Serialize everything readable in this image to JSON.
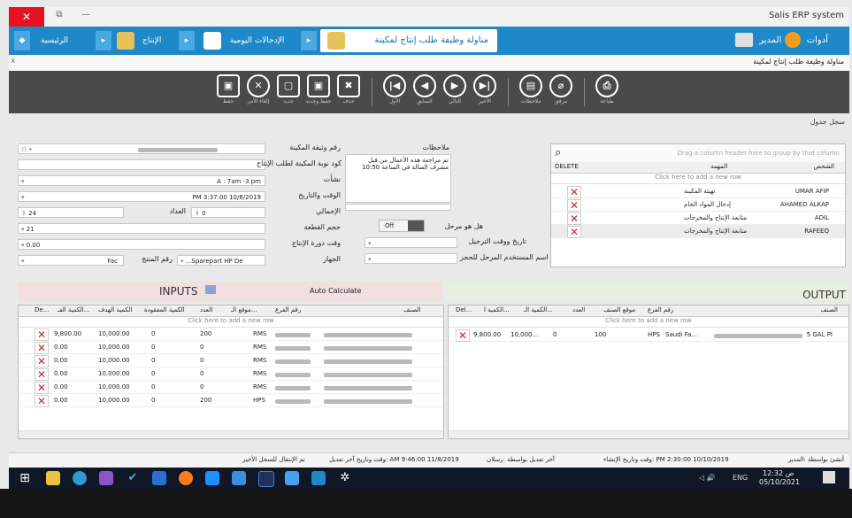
{
  "window": {
    "title": "Salis ERP system",
    "close_glyph": "✕",
    "restore_glyph": "⧉",
    "min_glyph": "—"
  },
  "nav": {
    "home": "الرئيسية",
    "production": "الإنتاج",
    "daily_entries": "الإدخالات اليومية",
    "active_tab": "مناولة وظيفة طلب إنتاج لمكينة",
    "tools": "أدوات",
    "user": "المدير"
  },
  "subbar": {
    "close_x": "x",
    "doc_tab": "مناولة وظيفة طلب إنتاج لمكينة"
  },
  "toolbar": {
    "save": "حفظ",
    "cancel": "إلغاء الأمر",
    "new": "جديد",
    "save_new": "حفظ وجديد",
    "delete": "حذف",
    "first": "الأول",
    "prev": "السابق",
    "next": "التالي",
    "last": "الأخير",
    "notes": "ملاحظات",
    "attach": "مرفق",
    "print": "طباعة"
  },
  "crumbs": {
    "left": "سجل  جدول"
  },
  "form": {
    "labels": {
      "machine_doc_no": "رقم وثيقة المكينة",
      "shift_code": "كود نوبة المكينة لطلب الإنتاج",
      "shift": "نشأت",
      "time_date": "الوقت والتاريخ",
      "total": "الإجمالي",
      "piece_size": "حجم القطعة",
      "cycle_time": "وقت دورة الإنتاج",
      "machine": "الجهاز",
      "counter": "العداد",
      "product_no": "رقم المنتج",
      "notes": "ملاحظات"
    },
    "values": {
      "shift_value": "A : 7am -3 pm",
      "datetime_value": "PM 3:37:00 10/8/2019",
      "total_value": "24",
      "piece_value": "21",
      "cycle_value": "0.00",
      "fac": "Fac",
      "sparepart": "...Sparepart HP De",
      "counter_value": "0",
      "notes_text": "تم مراجعة هذه الأعمال من قبل مشرف الصالة في الساعة 10:50",
      "toggle": "Off"
    },
    "qs": {
      "stage": "هل هو مرحل",
      "transfer_time": "تاريخ ووقت الترحيل",
      "transfer_user": "اسم المستخدم المرحل للحجز"
    }
  },
  "tasks_grid": {
    "hint": "Drag a column header here to group by that column",
    "headers": {
      "person": "الشخص",
      "task": "المهمة",
      "delete": "DELETE"
    },
    "add_row": "Click here to add a new row",
    "rows": [
      {
        "person": "UMAR AFIP",
        "task": "تهيئة المكينة"
      },
      {
        "person": "AHAMED ALKAP",
        "task": "إدخال المواد الخام"
      },
      {
        "person": "ADIL",
        "task": "متابعة الإنتاج والمخرجات"
      },
      {
        "person": "RAFEEQ",
        "task": "متابعة الإنتاج والمخرجات"
      }
    ]
  },
  "inputs": {
    "title": "INPUTS",
    "auto_calc": "Auto Calculate",
    "headers": {
      "item": "الصنف",
      "branch_no": "رقم الفرع",
      "location": "موقع الـ...",
      "count": "العدد",
      "qty_wasted": "الكمية المفقودة",
      "target_qty": "الكمية الهدف",
      "actual_qty": "الكمية الفـ...",
      "del": "De..."
    },
    "add_row": "Click here to add a new row",
    "rows": [
      {
        "loc": "RMS",
        "count": "200",
        "wasted": "0",
        "target": "10,000.00",
        "actual": "9,800.00"
      },
      {
        "loc": "RMS",
        "count": "0",
        "wasted": "0",
        "target": "10,000.00",
        "actual": "0.00"
      },
      {
        "loc": "RMS",
        "count": "0",
        "wasted": "0",
        "target": "10,000.00",
        "actual": "0.00"
      },
      {
        "loc": "RMS",
        "count": "0",
        "wasted": "0",
        "target": "10,000.00",
        "actual": "0.00"
      },
      {
        "loc": "RMS",
        "count": "0",
        "wasted": "0",
        "target": "10,000.00",
        "actual": "0.00"
      },
      {
        "loc": "HPS",
        "count": "200",
        "wasted": "0",
        "target": "10,000.00",
        "actual": "0.00"
      }
    ]
  },
  "output": {
    "title": "OUTPUT",
    "headers": {
      "item": "الصنف",
      "branch_no": "رقم الفرع",
      "location": "موقع الصنف",
      "count": "العدد",
      "qty1": "الكمية الـ...",
      "qty2": "الكمية ا...",
      "del": "Del..."
    },
    "add_row": "Click here to add a new row",
    "row": {
      "item": "5 GAL PI",
      "branch": "Saudi Fa...",
      "loc": "HPS",
      "count": "100",
      "qty1": "0",
      "qty2": "10,000...",
      "qty3": "9,800.00"
    }
  },
  "statusbar": {
    "created_by": "أنشئ بواسطة :المدير",
    "created_at": "وقت وتاريخ الإنشاء: PM 2:30:00 10/10/2019",
    "modified_by": "آخر تعديل بواسطة :رسلان",
    "modified_at": "وقت وتاريخ آخر تعديل: AM 9:46:00 11/8/2019",
    "go_last": "تم الإنتقال للسجل الأخير"
  },
  "taskbar": {
    "lang": "ENG",
    "time": "12:32 ص",
    "date": "05/10/2021"
  }
}
